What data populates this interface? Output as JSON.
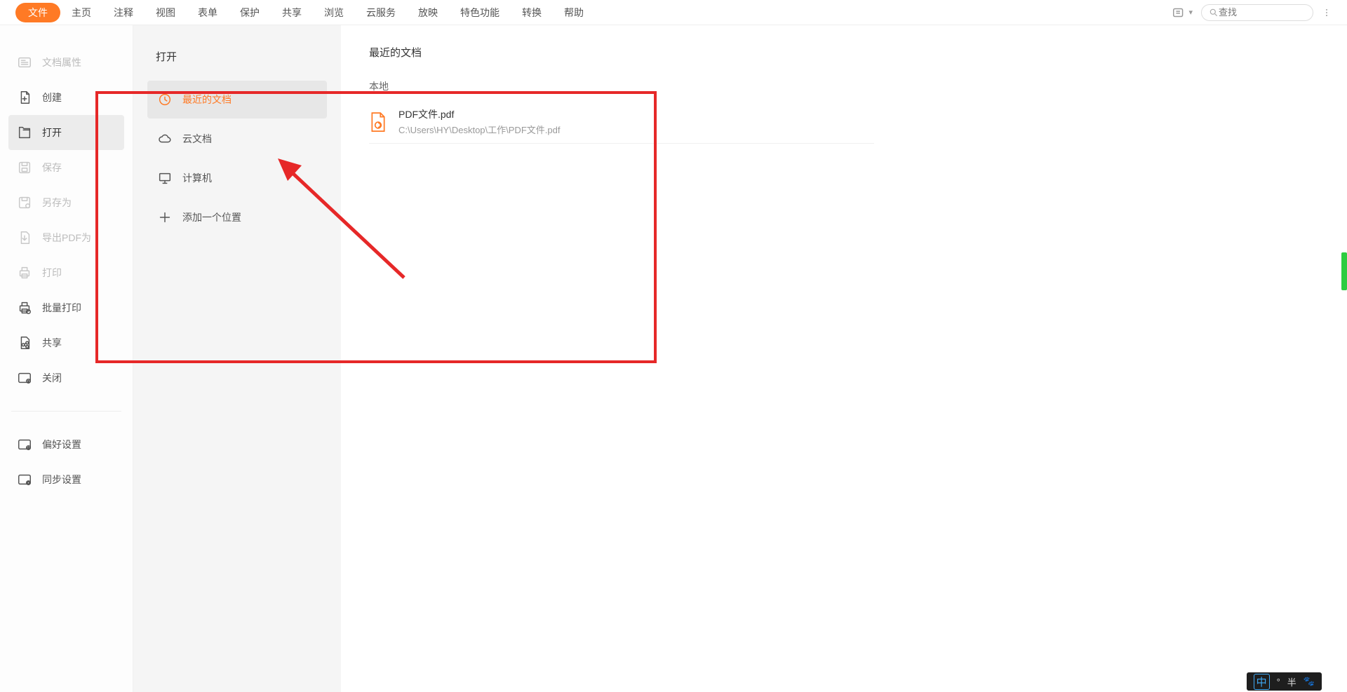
{
  "topbar": {
    "tabs": [
      "文件",
      "主页",
      "注释",
      "视图",
      "表单",
      "保护",
      "共享",
      "浏览",
      "云服务",
      "放映",
      "特色功能",
      "转换",
      "帮助"
    ],
    "active_tab_index": 0,
    "search_placeholder": "查找"
  },
  "sidebar1": {
    "items": [
      {
        "label": "文档属性",
        "disabled": true,
        "icon": "properties"
      },
      {
        "label": "创建",
        "disabled": false,
        "icon": "create"
      },
      {
        "label": "打开",
        "disabled": false,
        "active": true,
        "icon": "open"
      },
      {
        "label": "保存",
        "disabled": true,
        "icon": "save"
      },
      {
        "label": "另存为",
        "disabled": true,
        "icon": "saveas"
      },
      {
        "label": "导出PDF为",
        "disabled": true,
        "icon": "export"
      },
      {
        "label": "打印",
        "disabled": true,
        "icon": "print"
      },
      {
        "label": "批量打印",
        "disabled": false,
        "icon": "batchprint"
      },
      {
        "label": "共享",
        "disabled": false,
        "icon": "share"
      },
      {
        "label": "关闭",
        "disabled": false,
        "icon": "close"
      }
    ],
    "footer_items": [
      {
        "label": "偏好设置",
        "icon": "pref"
      },
      {
        "label": "同步设置",
        "icon": "sync"
      }
    ]
  },
  "sidebar2": {
    "title": "打开",
    "items": [
      {
        "label": "最近的文档",
        "active": true,
        "icon": "recent"
      },
      {
        "label": "云文档",
        "icon": "cloud"
      },
      {
        "label": "计算机",
        "icon": "computer"
      },
      {
        "label": "添加一个位置",
        "icon": "add"
      }
    ]
  },
  "content": {
    "title": "最近的文档",
    "section_label": "本地",
    "docs": [
      {
        "name": "PDF文件.pdf",
        "path": "C:\\Users\\HY\\Desktop\\工作\\PDF文件.pdf"
      }
    ]
  },
  "ime": {
    "main": "中",
    "dot": "°",
    "half": "半",
    "paw": "🐾"
  }
}
